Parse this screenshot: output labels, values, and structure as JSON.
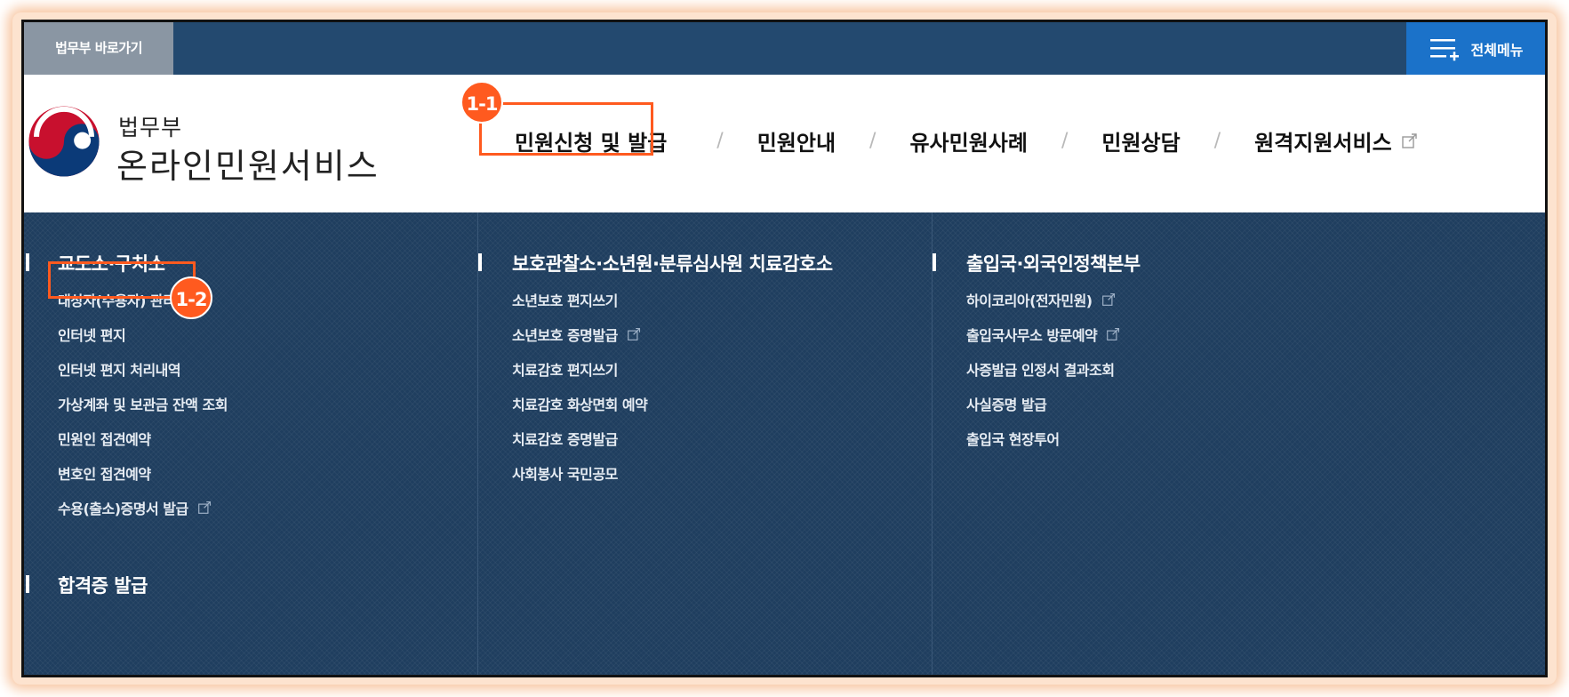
{
  "topbar": {
    "shortcut_label": "법무부 바로가기",
    "all_menu_label": "전체메뉴"
  },
  "logo": {
    "ministry": "법무부",
    "service_name": "온라인민원서비스"
  },
  "gnb": {
    "items": [
      {
        "label": "민원신청 및 발급"
      },
      {
        "label": "민원안내"
      },
      {
        "label": "유사민원사례"
      },
      {
        "label": "민원상담"
      },
      {
        "label": "원격지원서비스",
        "external": true
      }
    ],
    "separator": "/"
  },
  "columns": [
    {
      "title": "교도소·구치소",
      "links": [
        {
          "label": "대상자(수용자) 관리"
        },
        {
          "label": "인터넷 편지"
        },
        {
          "label": "인터넷 편지 처리내역"
        },
        {
          "label": "가상계좌 및 보관금 잔액 조회"
        },
        {
          "label": "민원인 접견예약"
        },
        {
          "label": "변호인 접견예약"
        },
        {
          "label": "수용(출소)증명서 발급",
          "external": true
        }
      ],
      "sub_title": "합격증 발급"
    },
    {
      "title": "보호관찰소·소년원·분류심사원 치료감호소",
      "links": [
        {
          "label": "소년보호 편지쓰기"
        },
        {
          "label": "소년보호 증명발급",
          "external": true
        },
        {
          "label": "치료감호 편지쓰기"
        },
        {
          "label": "치료감호 화상면회 예약"
        },
        {
          "label": "치료감호 증명발급"
        },
        {
          "label": "사회봉사 국민공모"
        }
      ]
    },
    {
      "title": "출입국·외국인정책본부",
      "links": [
        {
          "label": "하이코리아(전자민원)",
          "external": true
        },
        {
          "label": "출입국사무소 방문예약",
          "external": true
        },
        {
          "label": "사증발급 인정서 결과조회"
        },
        {
          "label": "사실증명 발급"
        },
        {
          "label": "출입국 현장투어"
        }
      ]
    }
  ],
  "annotations": {
    "badge_1": "1-1",
    "badge_2": "1-2",
    "accent_color": "#ff5a1f"
  },
  "colors": {
    "topbar": "#23496f",
    "all_menu": "#1b72c9",
    "shortcut": "#8a96a3",
    "panel": "#1f3e5f"
  }
}
